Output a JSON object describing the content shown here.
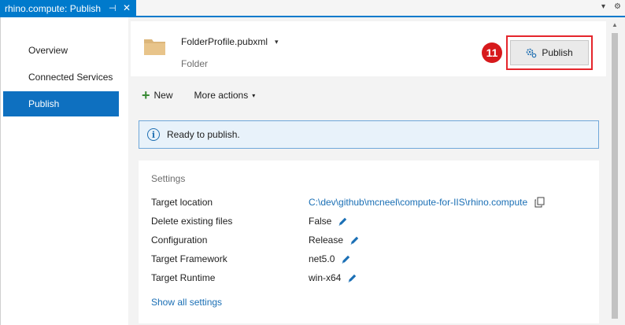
{
  "tab": {
    "title": "rhino.compute: Publish",
    "pin": "⊣",
    "close": "✕"
  },
  "tabbar_icons": {
    "dropdown": "▾",
    "settings": "⚙"
  },
  "nav": {
    "items": [
      {
        "label": "Overview"
      },
      {
        "label": "Connected Services"
      },
      {
        "label": "Publish",
        "selected": true
      }
    ]
  },
  "profile": {
    "name": "FolderProfile.pubxml",
    "caret": "▾",
    "type": "Folder",
    "icon": "folder-icon"
  },
  "annotation": {
    "step": "11"
  },
  "publish_button": {
    "label": "Publish",
    "icon": "publish-gear-icon"
  },
  "actions": {
    "new_label": "New",
    "more_label": "More actions",
    "caret": "▾"
  },
  "status": {
    "message": "Ready to publish.",
    "icon_glyph": "i"
  },
  "settings": {
    "title": "Settings",
    "rows": [
      {
        "label": "Target location",
        "value": "C:\\dev\\github\\mcneel\\compute-for-IIS\\rhino.compute"
      },
      {
        "label": "Delete existing files",
        "value": "False"
      },
      {
        "label": "Configuration",
        "value": "Release"
      },
      {
        "label": "Target Framework",
        "value": "net5.0"
      },
      {
        "label": "Target Runtime",
        "value": "win-x64"
      }
    ],
    "show_all": "Show all settings"
  },
  "scrollbar": {
    "up_arrow": "▲"
  },
  "colors": {
    "accent": "#007acc",
    "selected_nav": "#0e70c0",
    "link": "#1a6fb5",
    "annotation_red": "#d7191c",
    "info_bg": "#e8f2fa"
  }
}
